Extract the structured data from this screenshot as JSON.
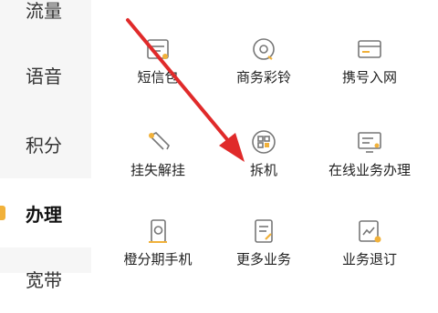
{
  "sidebar": {
    "items": [
      {
        "label": "流量"
      },
      {
        "label": "语音"
      },
      {
        "label": "积分"
      },
      {
        "label": "办理",
        "active": true
      },
      {
        "label": "宽带"
      }
    ]
  },
  "services": {
    "items": [
      {
        "label": "短信包",
        "icon": "sms-icon"
      },
      {
        "label": "商务彩铃",
        "icon": "ringtone-icon"
      },
      {
        "label": "携号入网",
        "icon": "card-transfer-icon"
      },
      {
        "label": "挂失解挂",
        "icon": "sim-lock-icon"
      },
      {
        "label": "拆机",
        "icon": "phone-unbind-icon"
      },
      {
        "label": "在线业务办理",
        "icon": "online-service-icon"
      },
      {
        "label": "橙分期手机",
        "icon": "installment-phone-icon"
      },
      {
        "label": "更多业务",
        "icon": "more-services-icon"
      },
      {
        "label": "业务退订",
        "icon": "unsubscribe-icon"
      }
    ]
  },
  "theme": {
    "accent": "#f1b13a",
    "icon_stroke": "#777777",
    "arrow": "#e02a2a"
  }
}
